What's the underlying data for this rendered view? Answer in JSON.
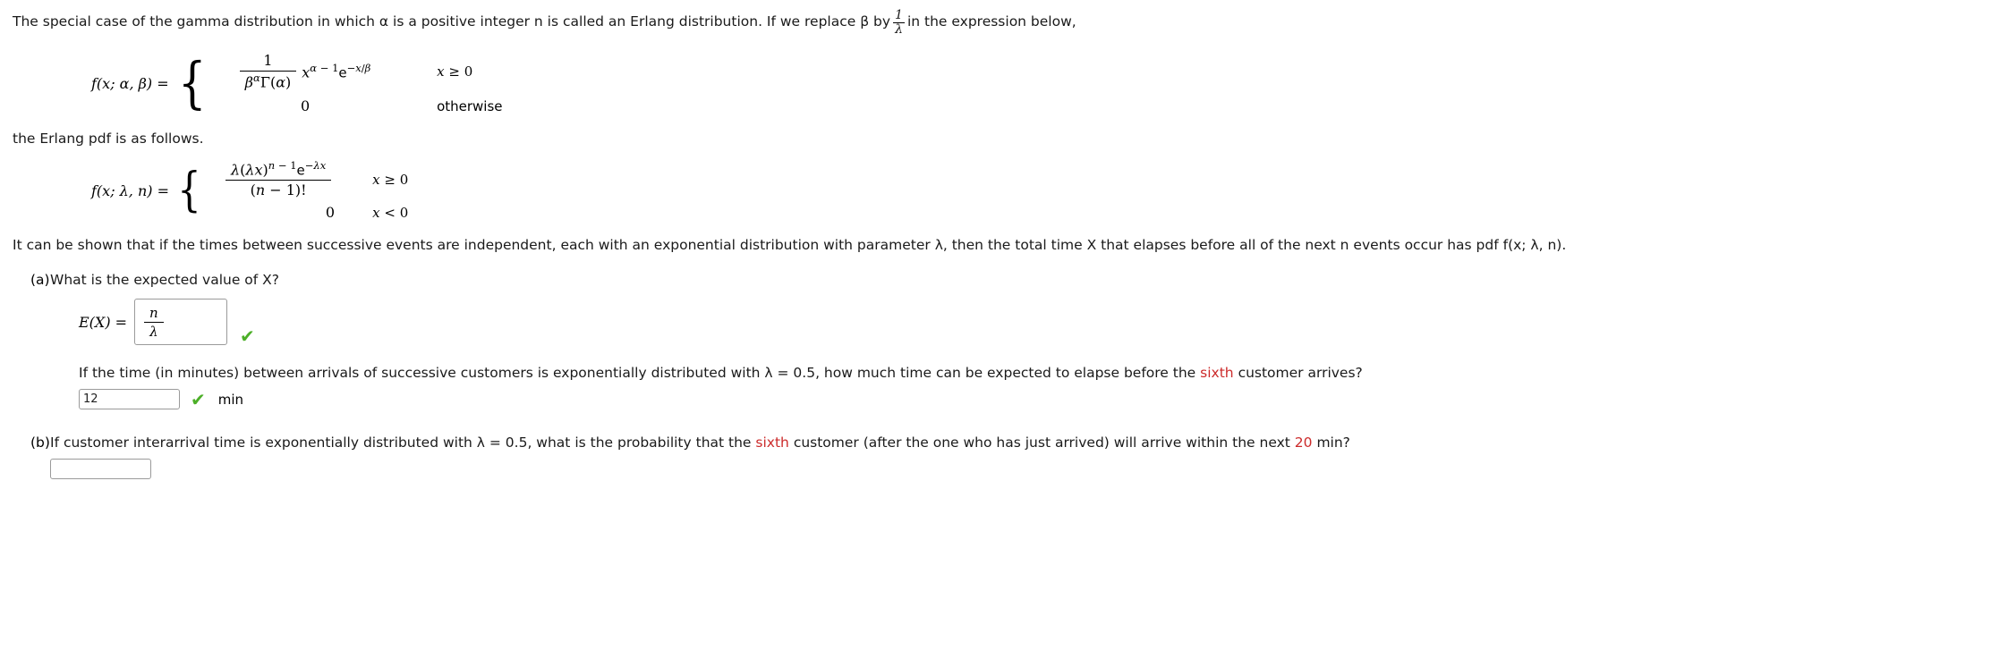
{
  "intro": {
    "text_before_frac": "The special case of the gamma distribution in which α is a positive integer n is called an Erlang distribution. If we replace β by",
    "frac_num": "1",
    "frac_den": "λ",
    "text_after_frac": "in the expression below,"
  },
  "gamma_equation": {
    "lhs": "f(x; α, β) =",
    "case1_numerator": "1",
    "case1_denominator": "βαΓ(α)",
    "case1_factor": "xα − 1e−x/β",
    "case1_condition": "x ≥ 0",
    "case2_value": "0",
    "case2_condition": "otherwise"
  },
  "middle_text": "the Erlang pdf is as follows.",
  "erlang_equation": {
    "lhs": "f(x; λ, n) =",
    "case1_numerator": "λ(λx)n − 1e−λx",
    "case1_denominator": "(n − 1)!",
    "case1_condition": "x ≥ 0",
    "case2_value": "0",
    "case2_condition": "x < 0"
  },
  "body_text": "It can be shown that if the times between successive events are independent, each with an exponential distribution with parameter λ, then the total time X that elapses before all of the next n events occur has pdf f(x; λ, n).",
  "part_a": {
    "label": "(a)",
    "question": "What is the expected value of X?",
    "answer_label": "E(X) =",
    "answer_numerator": "n",
    "answer_denominator": "λ",
    "answer_correct_icon": "checkmark-icon",
    "followup_question_parts": {
      "p1": "If the time (in minutes) between arrivals of successive customers is exponentially distributed with λ = 0.5, how much time can be expected to elapse before the",
      "highlight": "sixth",
      "p2": "customer arrives?"
    },
    "followup_answer_value": "12",
    "followup_answer_placeholder": "",
    "followup_unit": "min",
    "followup_correct_icon": "checkmark-icon"
  },
  "part_b": {
    "label": "(b)",
    "question_p1": "If customer interarrival time is exponentially distributed with λ = 0.5, what is the probability that the",
    "highlight1": "sixth",
    "question_p2": "customer (after the one who has just arrived) will arrive within the next",
    "highlight2": "20",
    "question_p3": "min?",
    "answer_value": "",
    "answer_placeholder": ""
  },
  "colors": {
    "highlight": "#cc2b2b",
    "check": "#4caf28",
    "border": "#9a9a9a"
  }
}
